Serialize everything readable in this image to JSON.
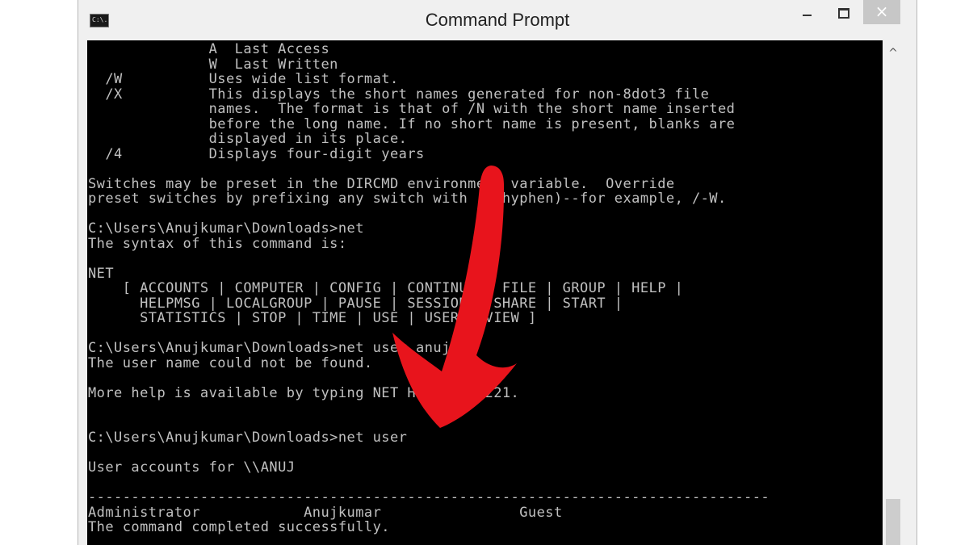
{
  "window": {
    "title": "Command Prompt",
    "icon_text": "C:\\.",
    "buttons": {
      "minimize": "minimize-icon",
      "maximize": "maximize-icon",
      "close": "×"
    }
  },
  "scrollbar": {
    "up_arrow": "^"
  },
  "console": {
    "lines": [
      "              A  Last Access",
      "              W  Last Written",
      "  /W          Uses wide list format.",
      "  /X          This displays the short names generated for non-8dot3 file",
      "              names.  The format is that of /N with the short name inserted",
      "              before the long name. If no short name is present, blanks are",
      "              displayed in its place.",
      "  /4          Displays four-digit years",
      "",
      "Switches may be preset in the DIRCMD environment variable.  Override",
      "preset switches by prefixing any switch with - (hyphen)--for example, /-W.",
      "",
      "C:\\Users\\Anujkumar\\Downloads>net",
      "The syntax of this command is:",
      "",
      "NET",
      "    [ ACCOUNTS | COMPUTER | CONFIG | CONTINUE | FILE | GROUP | HELP |",
      "      HELPMSG | LOCALGROUP | PAUSE | SESSION | SHARE | START |",
      "      STATISTICS | STOP | TIME | USE | USER | VIEW ]",
      "",
      "C:\\Users\\Anujkumar\\Downloads>net user anuj",
      "The user name could not be found.",
      "",
      "More help is available by typing NET HELPMSG 2221.",
      "",
      "",
      "C:\\Users\\Anujkumar\\Downloads>net user",
      "",
      "User accounts for \\\\ANUJ",
      "",
      "-------------------------------------------------------------------------------",
      "Administrator            Anujkumar                Guest",
      "The command completed successfully."
    ]
  },
  "annotation": {
    "arrow_color": "#e8141c"
  }
}
